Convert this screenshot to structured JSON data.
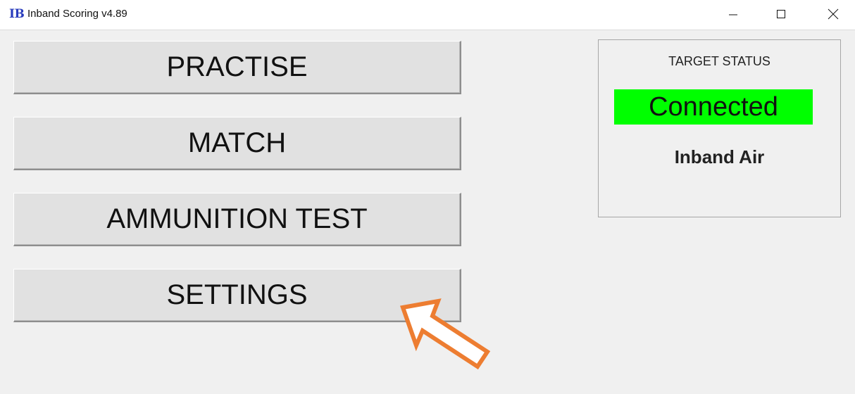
{
  "titlebar": {
    "icon_text": "IB",
    "title": "Inband Scoring v4.89"
  },
  "buttons": {
    "practise": "PRACTISE",
    "match": "MATCH",
    "ammunition_test": "AMMUNITION TEST",
    "settings": "SETTINGS"
  },
  "target_status": {
    "title": "TARGET STATUS",
    "connection": "Connected",
    "target_type": "Inband Air"
  },
  "colors": {
    "connected_bg": "#00ff00",
    "icon_color": "#2a3dbd",
    "arrow_color": "#ed7d31"
  }
}
